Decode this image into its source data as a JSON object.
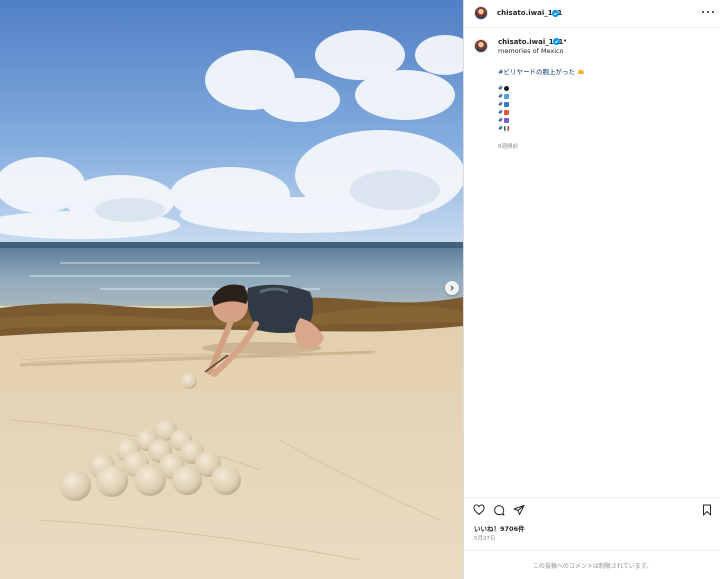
{
  "post": {
    "username": "chisato.iwai_101",
    "separator": "•",
    "caption_title": "memories of Mexico",
    "hashtag": "#ビリヤードの腕上がった",
    "hashtag_emoji": "flexed-biceps",
    "hashtag_lines": [
      {
        "text": "#",
        "emoji": "pool-8-ball",
        "color": "#1a1a1a"
      },
      {
        "text": "#",
        "emoji": "beach-umbrella",
        "color": "#4aa3df"
      },
      {
        "text": "#",
        "emoji": "water-wave",
        "color": "#2f7fd1"
      },
      {
        "text": "#",
        "emoji": "sushi",
        "color": "#e8553a"
      },
      {
        "text": "#",
        "emoji": "musical-note",
        "color": "#7a5bd6"
      },
      {
        "text": "#",
        "emoji": "flag-mexico",
        "color": "#d23b2f"
      }
    ],
    "time_ago": "8週間前",
    "likes_text": "いいね！9706件",
    "date": "5月27日",
    "comments_disabled": "この投稿へのコメントは制限されています。"
  },
  "colors": {
    "link": "#00376b",
    "verified": "#0095f6",
    "muted": "#8e8e8e"
  },
  "icons": {
    "like": "heart-icon",
    "comment": "comment-icon",
    "share": "share-icon",
    "save": "bookmark-icon",
    "more": "more-options-icon",
    "next": "chevron-right-icon"
  }
}
